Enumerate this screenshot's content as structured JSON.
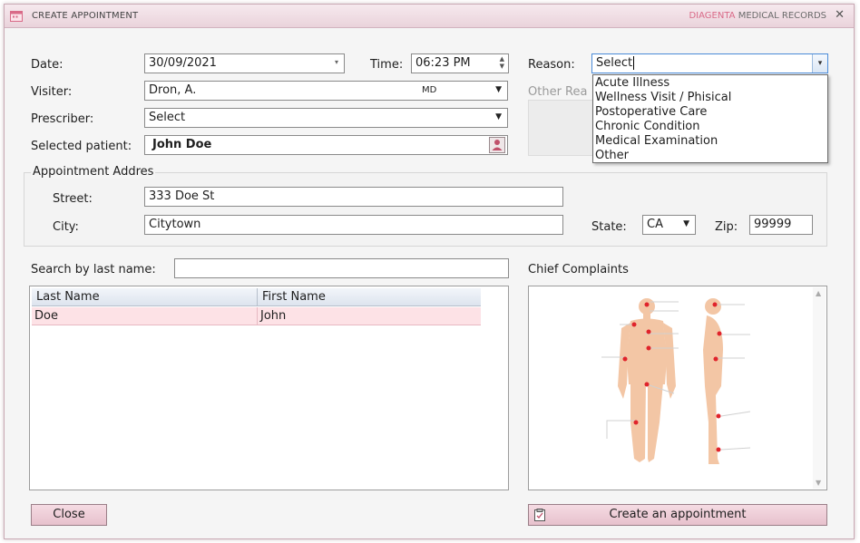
{
  "window": {
    "title": "CREATE APPOINTMENT",
    "brand_primary": "DIAGENTA",
    "brand_secondary": "MEDICAL RECORDS",
    "close_glyph": "✕"
  },
  "form": {
    "date_label": "Date:",
    "date_value": "30/09/2021",
    "time_label": "Time:",
    "time_value": "06:23 PM",
    "reason_label": "Reason:",
    "reason_value": "Select",
    "visiter_label": "Visiter:",
    "visiter_value": "Dron, A.",
    "visiter_suffix": "MD",
    "other_reason_label": "Other Rea",
    "prescriber_label": "Prescriber:",
    "prescriber_value": "Select",
    "selected_patient_label": "Selected patient:",
    "selected_patient_value": "John Doe"
  },
  "reason_options": [
    "Acute Illness",
    "Wellness Visit / Phisical",
    "Postoperative Care",
    "Chronic Condition",
    "Medical Examination",
    "Other"
  ],
  "address": {
    "group_label": "Appointment Addres",
    "street_label": "Street:",
    "street_value": "333 Doe St",
    "city_label": "City:",
    "city_value": "Citytown",
    "state_label": "State:",
    "state_value": "CA",
    "zip_label": "Zip:",
    "zip_value": "99999"
  },
  "search": {
    "label": "Search by last name:",
    "value": ""
  },
  "table": {
    "columns": [
      "Last Name",
      "First Name"
    ],
    "rows": [
      [
        "Doe",
        "John"
      ]
    ]
  },
  "complaints": {
    "label": "Chief Complaints"
  },
  "buttons": {
    "close_label": "Close",
    "create_label": "Create an appointment"
  },
  "colors": {
    "accent_pink": "#d96a88",
    "selected_row": "#fde2e6",
    "button_bg": "#e7c1cd",
    "body_skin": "#f3c6a5",
    "marker_red": "#e0232b"
  },
  "icons": [
    "calendar-icon",
    "close-icon",
    "patient-lookup-icon",
    "chevron-down-icon",
    "clipboard-icon"
  ]
}
